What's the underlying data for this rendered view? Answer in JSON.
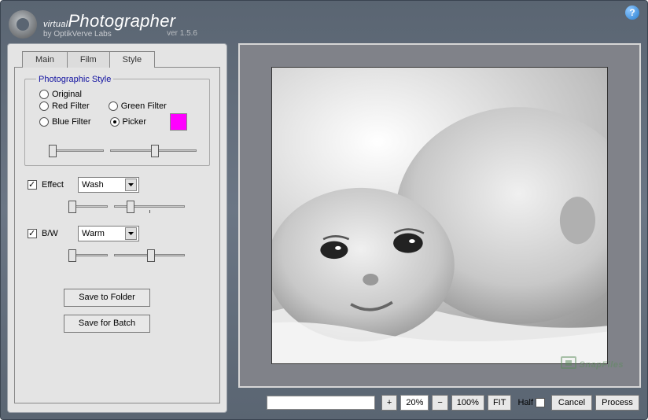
{
  "app": {
    "title_prefix": "virtual",
    "title_main": "Photographer",
    "subtitle": "by OptikVerve Labs",
    "version": "ver 1.5.6"
  },
  "tabs": [
    "Main",
    "Film",
    "Style"
  ],
  "active_tab": "Style",
  "fieldset": {
    "legend": "Photographic Style",
    "radios": {
      "original": "Original",
      "red": "Red Filter",
      "green": "Green Filter",
      "blue": "Blue Filter",
      "picker": "Picker"
    },
    "selected": "picker",
    "picker_color": "#ff00ff"
  },
  "effect": {
    "label": "Effect",
    "value": "Wash",
    "checked": true
  },
  "bw": {
    "label": "B/W",
    "value": "Warm",
    "checked": true
  },
  "buttons": {
    "save_folder": "Save to Folder",
    "save_batch": "Save for Batch"
  },
  "bottom": {
    "plus": "+",
    "zoom": "20%",
    "minus": "−",
    "hundred": "100%",
    "fit": "FIT",
    "half": "Half",
    "half_checked": false,
    "cancel": "Cancel",
    "process": "Process"
  },
  "watermark": "SnapFiles"
}
